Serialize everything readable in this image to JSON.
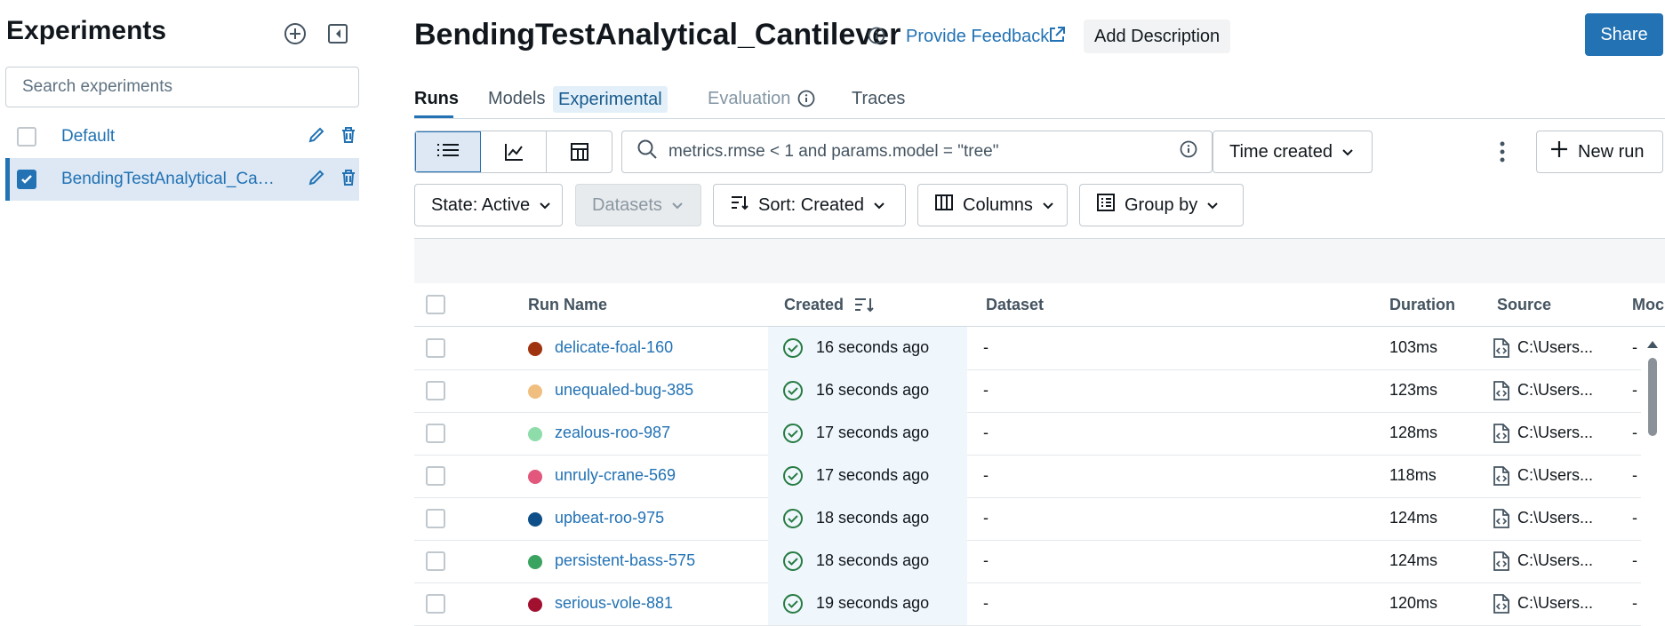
{
  "sidebar": {
    "title": "Experiments",
    "search_placeholder": "Search experiments",
    "items": [
      {
        "label": "Default",
        "checked": false
      },
      {
        "label": "BendingTestAnalytical_Canti...",
        "checked": true
      }
    ]
  },
  "header": {
    "title": "BendingTestAnalytical_Cantilever",
    "feedback_label": "Provide Feedback",
    "add_description_label": "Add Description",
    "share_label": "Share"
  },
  "tabs": [
    {
      "label": "Runs",
      "active": true
    },
    {
      "label": "Models",
      "badge": "Experimental"
    },
    {
      "label": "Evaluation"
    },
    {
      "label": "Traces"
    }
  ],
  "toolbar": {
    "filter_text": "metrics.rmse < 1 and params.model = \"tree\"",
    "time_created_label": "Time created",
    "new_run_label": "New run",
    "state_label": "State: Active",
    "datasets_label": "Datasets",
    "sort_label": "Sort: Created",
    "columns_label": "Columns",
    "group_by_label": "Group by"
  },
  "table": {
    "headers": {
      "run_name": "Run Name",
      "created": "Created",
      "dataset": "Dataset",
      "duration": "Duration",
      "source": "Source",
      "models": "Moc"
    },
    "rows": [
      {
        "name": "delicate-foal-160",
        "color": "#a0330f",
        "created": "16 seconds ago",
        "dataset": "-",
        "duration": "103ms",
        "source": "C:\\Users...",
        "models": "-"
      },
      {
        "name": "unequaled-bug-385",
        "color": "#f0bf80",
        "created": "16 seconds ago",
        "dataset": "-",
        "duration": "123ms",
        "source": "C:\\Users...",
        "models": "-"
      },
      {
        "name": "zealous-roo-987",
        "color": "#8edcaa",
        "created": "17 seconds ago",
        "dataset": "-",
        "duration": "128ms",
        "source": "C:\\Users...",
        "models": "-"
      },
      {
        "name": "unruly-crane-569",
        "color": "#e2577b",
        "created": "17 seconds ago",
        "dataset": "-",
        "duration": "118ms",
        "source": "C:\\Users...",
        "models": "-"
      },
      {
        "name": "upbeat-roo-975",
        "color": "#0e4f8a",
        "created": "18 seconds ago",
        "dataset": "-",
        "duration": "124ms",
        "source": "C:\\Users...",
        "models": "-"
      },
      {
        "name": "persistent-bass-575",
        "color": "#3aa360",
        "created": "18 seconds ago",
        "dataset": "-",
        "duration": "124ms",
        "source": "C:\\Users...",
        "models": "-"
      },
      {
        "name": "serious-vole-881",
        "color": "#a1102f",
        "created": "19 seconds ago",
        "dataset": "-",
        "duration": "120ms",
        "source": "C:\\Users...",
        "models": "-"
      }
    ]
  },
  "colors": {
    "accent": "#2272b4",
    "success": "#277c43"
  }
}
